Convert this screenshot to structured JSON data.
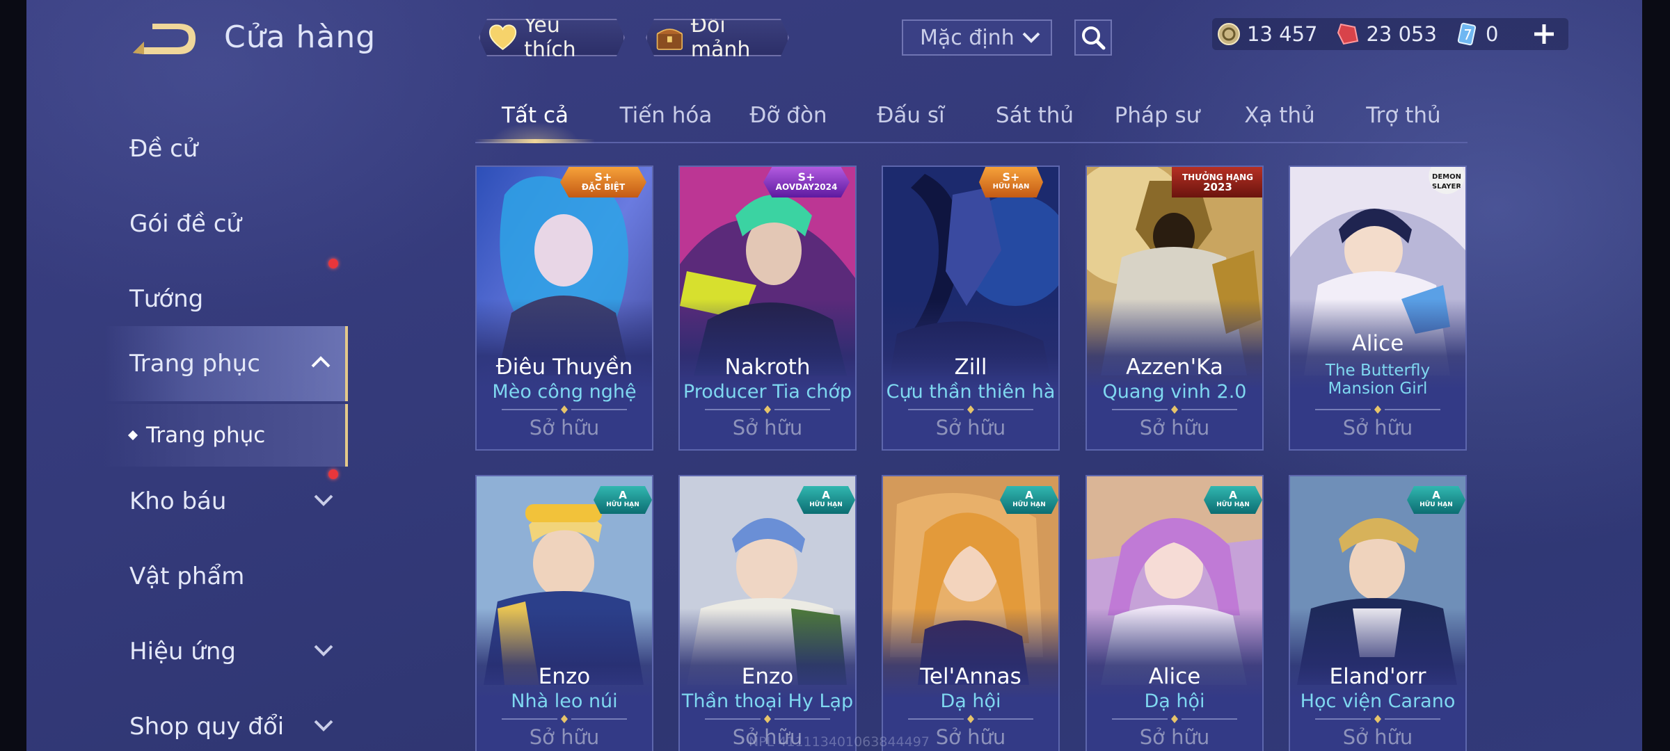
{
  "header": {
    "title": "Cửa hàng",
    "favorites_label": "Yêu thích",
    "shards_label": "Đổi mảnh",
    "sort_value": "Mặc định"
  },
  "currencies": [
    {
      "icon": "gold-coin-icon",
      "value": "13 457"
    },
    {
      "icon": "red-voucher-icon",
      "value": "23 053"
    },
    {
      "icon": "blue-card-icon",
      "value": "0"
    }
  ],
  "sidebar": {
    "items": [
      {
        "label": "Đề cử"
      },
      {
        "label": "Gói đề cử"
      },
      {
        "label": "Tướng"
      },
      {
        "label": "Trang phục"
      },
      {
        "label": "Trang phục"
      },
      {
        "label": "Kho báu"
      },
      {
        "label": "Vật phẩm"
      },
      {
        "label": "Hiệu ứng"
      },
      {
        "label": "Shop quy đổi"
      }
    ]
  },
  "tabs": [
    "Tất cả",
    "Tiến hóa",
    "Đỡ đòn",
    "Đấu sĩ",
    "Sát thủ",
    "Pháp sư",
    "Xạ thủ",
    "Trợ thủ"
  ],
  "cards": [
    {
      "hero": "Điêu Thuyền",
      "skin": "Mèo công nghệ",
      "status": "Sở hữu",
      "badge_line1": "S+",
      "badge_line2": "ĐẶC BIỆT"
    },
    {
      "hero": "Nakroth",
      "skin": "Producer Tia chớp",
      "status": "Sở hữu",
      "badge_line1": "S+",
      "badge_line2": "AOVDAY2024"
    },
    {
      "hero": "Zill",
      "skin": "Cựu thần thiên hà",
      "status": "Sở hữu",
      "badge_line1": "S+",
      "badge_line2": "HỮU HẠN"
    },
    {
      "hero": "Azzen'Ka",
      "skin": "Quang vinh 2.0",
      "status": "Sở hữu",
      "badge_line1": "THƯỞNG HẠNG",
      "badge_line2": "2023"
    },
    {
      "hero": "Alice",
      "skin": "The Butterfly Mansion Girl",
      "status": "Sở hữu",
      "badge_line1": "DEMON",
      "badge_line2": "SLAYER"
    },
    {
      "hero": "Enzo",
      "skin": "Nhà leo núi",
      "status": "Sở hữu",
      "badge_line1": "A",
      "badge_line2": "HỮU HẠN"
    },
    {
      "hero": "Enzo",
      "skin": "Thần thoại Hy Lạp",
      "status": "Sở hữu",
      "badge_line1": "A",
      "badge_line2": "HỮU HẠN"
    },
    {
      "hero": "Tel'Annas",
      "skin": "Dạ hội",
      "status": "Sở hữu",
      "badge_line1": "A",
      "badge_line2": "HỮU HẠN"
    },
    {
      "hero": "Alice",
      "skin": "Dạ hội",
      "status": "Sở hữu",
      "badge_line1": "A",
      "badge_line2": "HỮU HẠN"
    },
    {
      "hero": "Eland'orr",
      "skin": "Học viện Carano",
      "status": "Sở hữu",
      "badge_line1": "A",
      "badge_line2": "HỮU HẠN"
    }
  ],
  "watermark": "NPL 411113401063844497",
  "colors": {
    "accent_gold": "#f0d79a",
    "skin_text": "#7fd8f0",
    "notify_red": "#e8363b"
  }
}
